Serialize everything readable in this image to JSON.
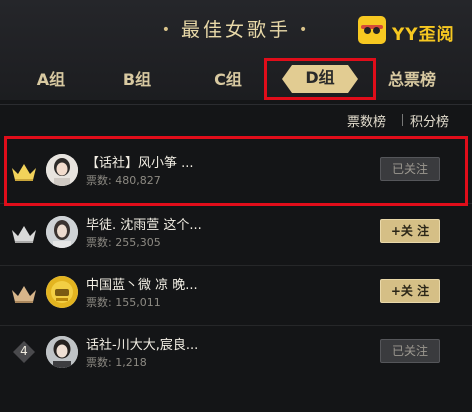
{
  "header": {
    "title": "最佳女歌手",
    "brand_text": "YY歪阅"
  },
  "tabs": [
    {
      "label": "A组",
      "active": false
    },
    {
      "label": "B组",
      "active": false
    },
    {
      "label": "C组",
      "active": false
    },
    {
      "label": "D组",
      "active": true
    },
    {
      "label": "总票榜",
      "active": false
    }
  ],
  "sort": {
    "votes_label": "票数榜",
    "points_label": "积分榜"
  },
  "entries": [
    {
      "rank": 1,
      "name": "【话社】风小筝 ...",
      "votes_label": "票数:",
      "votes": "480,827",
      "button": "已关注",
      "followed": true,
      "rank_icon": "gold-crown-icon"
    },
    {
      "rank": 2,
      "name": "毕徒. 沈雨萱 这个...",
      "votes_label": "票数:",
      "votes": "255,305",
      "button": "+关 注",
      "followed": false,
      "rank_icon": "silver-crown-icon"
    },
    {
      "rank": 3,
      "name": "中国蓝丶微 凉 晚...",
      "votes_label": "票数:",
      "votes": "155,011",
      "button": "+关 注",
      "followed": false,
      "rank_icon": "bronze-crown-icon"
    },
    {
      "rank": 4,
      "name": "话社-川大大,宸良...",
      "votes_label": "票数:",
      "votes": "1,218",
      "button": "已关注",
      "followed": true,
      "rank_icon": "rank-badge-icon"
    }
  ],
  "colors": {
    "accent_gold": "#d5bf86",
    "highlight_red": "#e00d1a",
    "background": "#141517"
  }
}
